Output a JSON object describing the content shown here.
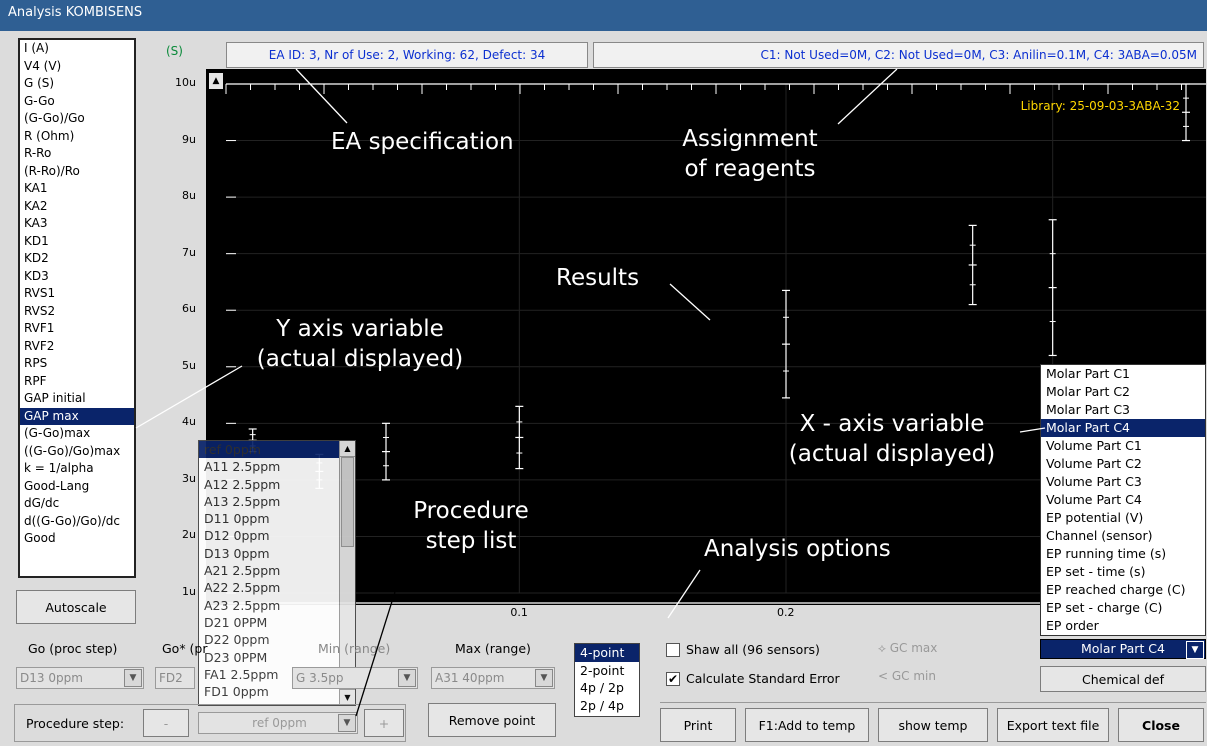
{
  "window": {
    "title": "Analysis KOMBISENS"
  },
  "y_variables": {
    "items": [
      "I (A)",
      "V4 (V)",
      "G (S)",
      "G-Go",
      "(G-Go)/Go",
      "R (Ohm)",
      "R-Ro",
      "(R-Ro)/Ro",
      "KA1",
      "KA2",
      "KA3",
      "KD1",
      "KD2",
      "KD3",
      "RVS1",
      "RVS2",
      "RVF1",
      "RVF2",
      "RPS",
      "RPF",
      "GAP initial",
      "GAP max",
      "(G-Go)max",
      "((G-Go)/Go)max",
      "k = 1/alpha",
      "Good-Lang",
      "dG/dc",
      "d((G-Go)/Go)/dc",
      "Good"
    ],
    "selected": "GAP max"
  },
  "header": {
    "y_unit": "(S)",
    "ea_info": "EA ID: 3, Nr of Use: 2, Working: 62, Defect: 34",
    "reagents": "C1: Not Used=0M, C2: Not Used=0M, C3: Anilin=0.1M, C4: 3ABA=0.05M"
  },
  "chart_data": {
    "type": "scatter",
    "ylim": [
      1,
      10
    ],
    "xlim": [
      -0.01,
      0.35
    ],
    "library": "Library: 25-09-03-3ABA-32",
    "y_ticks": [
      "10u",
      "9u",
      "8u",
      "7u",
      "6u",
      "5u",
      "4u",
      "3u",
      "2u",
      "1u"
    ],
    "x_ticks": [
      "0.1",
      "0.2",
      "0.3"
    ],
    "points": [
      {
        "x": 0,
        "y": 3.7,
        "err": 0.2
      },
      {
        "x": 0.025,
        "y": 3.15,
        "err": 0.3
      },
      {
        "x": 0.05,
        "y": 3.5,
        "err": 0.5
      },
      {
        "x": 0.1,
        "y": 3.75,
        "err": 0.55
      },
      {
        "x": 0.2,
        "y": 5.4,
        "err": 0.95
      },
      {
        "x": 0.27,
        "y": 6.8,
        "err": 0.7
      },
      {
        "x": 0.3,
        "y": 6.4,
        "err": 1.2
      },
      {
        "x": 0.35,
        "y": 9.5,
        "err": 0.5
      }
    ]
  },
  "annotations": {
    "ea_spec": "EA specification",
    "assignment": "Assignment",
    "assignment2": "of reagents",
    "results": "Results",
    "y_axis1": "Y axis variable",
    "y_axis2": "(actual displayed)",
    "x_axis1": "X - axis variable",
    "x_axis2": "(actual displayed)",
    "proc1": "Procedure",
    "proc2": "step list",
    "analysis_options": "Analysis options"
  },
  "procedure_list": {
    "items": [
      "ref 0ppm",
      "A11 2.5ppm",
      "A12 2.5ppm",
      "A13 2.5ppm",
      "D11 0ppm",
      "D12 0ppm",
      "D13 0ppm",
      "A21 2.5ppm",
      "A22 2.5ppm",
      "A23 2.5ppm",
      "D21 0PPM",
      "D22 0ppm",
      "D23 0PPM",
      "FA1 2.5ppm",
      "FD1 0ppm"
    ]
  },
  "x_variables": {
    "items": [
      "Molar Part C1",
      "Molar Part C2",
      "Molar Part C3",
      "Molar Part C4",
      "Volume Part C1",
      "Volume Part C2",
      "Volume Part C3",
      "Volume Part C4",
      "EP potential (V)",
      "Channel (sensor)",
      "EP running time (s)",
      "EP set - time (s)",
      "EP reached charge (C)",
      "EP set - charge (C)",
      "EP order"
    ],
    "selected": "Molar Part C4"
  },
  "controls": {
    "autoscale": "Autoscale",
    "go_label": "Go (proc step)",
    "go_value": "D13 0ppm",
    "gostar_label": "Go* (pr",
    "gostar_value": "FD2",
    "min_label": "Min (range)",
    "min_value": "G 3.5pp",
    "max_label": "Max (range)",
    "max_value": "A31 40ppm",
    "procedure_label": "Procedure step:",
    "minus": "-",
    "plus": "+",
    "procedure_value": "ref 0ppm",
    "remove_point": "Remove point",
    "point_options": [
      "4-point",
      "2-point",
      "4p / 2p",
      "2p / 4p"
    ],
    "show_all": "Shaw all (96 sensors)",
    "calc_se": "Calculate Standard Error",
    "gc_max": "GC max",
    "gc_min": "GC min",
    "chemical_def": "Chemical def"
  },
  "toolbar": {
    "print": "Print",
    "add_temp": "F1:Add to temp",
    "show_temp": "show temp",
    "export": "Export text file",
    "close": "Close"
  }
}
